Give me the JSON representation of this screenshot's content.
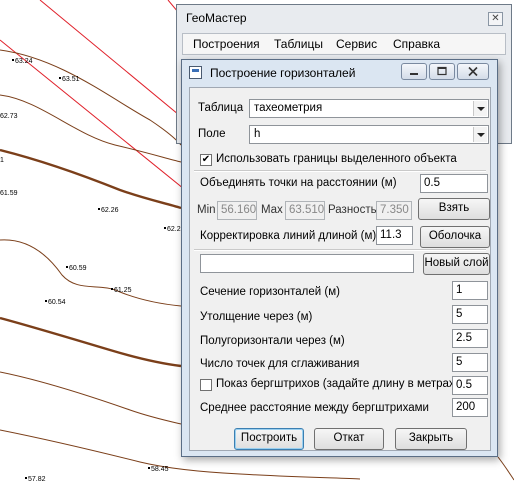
{
  "map": {
    "points": [
      {
        "name": "pt-63-24",
        "label": "63.24"
      },
      {
        "name": "pt-63-51",
        "label": "63.51"
      },
      {
        "name": "pt-62-73",
        "label": "62.73"
      },
      {
        "name": "pt-1",
        "label": "1"
      },
      {
        "name": "pt-61-59",
        "label": "61.59"
      },
      {
        "name": "pt-62-26",
        "label": "62.26"
      },
      {
        "name": "pt-62-2",
        "label": "62.2"
      },
      {
        "name": "pt-60-59",
        "label": "60.59"
      },
      {
        "name": "pt-61-25",
        "label": "61.25"
      },
      {
        "name": "pt-60-54",
        "label": "60.54"
      },
      {
        "name": "pt-58-45",
        "label": "58.45"
      },
      {
        "name": "pt-57-82",
        "label": "57.82"
      }
    ]
  },
  "main_window": {
    "title": "ГеоМастер",
    "close_glyph": "✕",
    "menu": [
      {
        "label": "Построения"
      },
      {
        "label": "Таблицы"
      },
      {
        "label": "Сервис"
      },
      {
        "label": "Справка"
      }
    ]
  },
  "dialog": {
    "title": "Построение горизонталей",
    "table_label": "Таблица",
    "table_value": "тахеометрия",
    "field_label": "Поле",
    "field_value": "h",
    "use_bounds": {
      "checked": true,
      "mark": "✔",
      "label": "Использовать границы выделенного объекта"
    },
    "merge_label": "Объединять точки на расстоянии (м)",
    "merge_value": "0.5",
    "min_label": "Min",
    "min_value": "56.160",
    "max_label": "Max",
    "max_value": "63.510",
    "diff_label": "Разность",
    "diff_value": "7.350",
    "take_button": "Взять",
    "correct_label": "Корректировка линий длиной (м)",
    "correct_value": "11.3",
    "shell_button": "Оболочка",
    "layer_name_value": "",
    "new_layer_button": "Новый слой",
    "section_label": "Сечение горизонталей (м)",
    "section_value": "1",
    "thicken_label": "Утолщение через (м)",
    "thicken_value": "5",
    "half_label": "Полугоризонтали через (м)",
    "half_value": "2.5",
    "smooth_label": "Число точек для сглаживания",
    "smooth_value": "5",
    "hachures": {
      "checked": false,
      "label": "Показ бергштрихов (задайте длину в метрах)",
      "value": "0.5"
    },
    "hachure_distance_label": "Среднее расстояние между бергштрихами",
    "hachure_distance_value": "200",
    "build_button": "Построить",
    "undo_button": "Откат",
    "close_button": "Закрыть"
  }
}
